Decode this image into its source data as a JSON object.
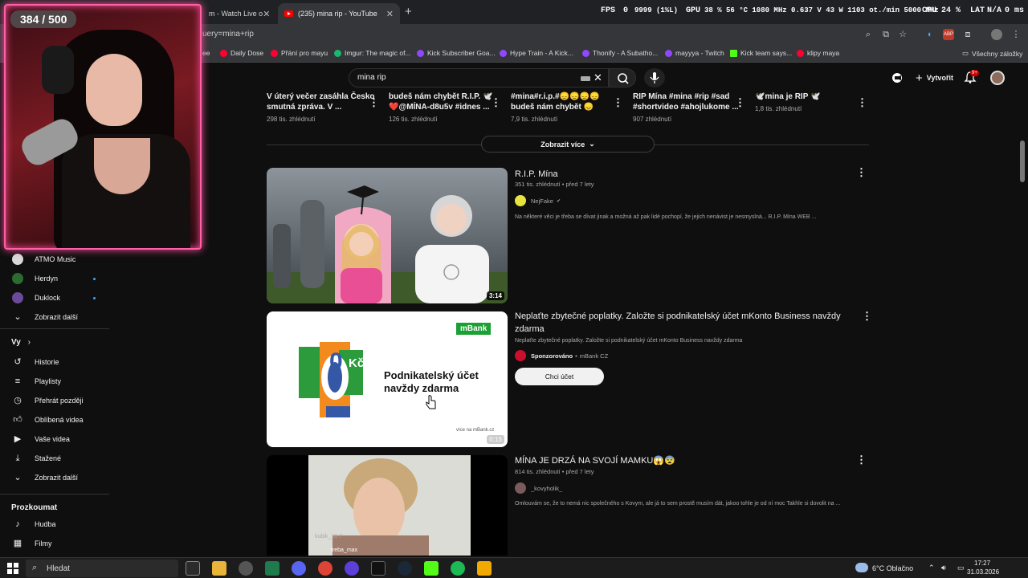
{
  "browser": {
    "tabs": [
      {
        "title": "m - Watch Live o"
      },
      {
        "title": "(235) mina rip - YouTube"
      }
    ],
    "new_tab": "+",
    "url": "uery=mina+rip",
    "bookmarks": [
      {
        "label": "ee",
        "color": "#cccccc"
      },
      {
        "label": "Daily Dose",
        "color": "#ff0033"
      },
      {
        "label": "Přání pro mayu",
        "color": "#ff0033"
      },
      {
        "label": "Imgur: The magic of...",
        "color": "#1bb76e"
      },
      {
        "label": "Kick Subscriber Goa...",
        "color": "#9147ff"
      },
      {
        "label": "Hype Train - A Kick...",
        "color": "#9147ff"
      },
      {
        "label": "Thonify - A Subatho...",
        "color": "#9147ff"
      },
      {
        "label": "mayyya - Twitch",
        "color": "#9147ff"
      },
      {
        "label": "Kick team says...",
        "color": "#53fc18"
      },
      {
        "label": "klipy maya",
        "color": "#ff0033"
      }
    ],
    "all_bookmarks": "Všechny záložky"
  },
  "overlay": {
    "fps_label": "FPS",
    "fps_value": "0",
    "fps_low": "9999 (1%L)",
    "gpu_label": "GPU",
    "gpu_values": "38 %  56 °C  1080 MHz  0.637 V  43 W  1103 ot./min  5000 MHz",
    "cpu_label": "CPU",
    "cpu_value": "24 %",
    "lat_label": "LAT",
    "lat_value": "N/A",
    "ms_value": "0 ms"
  },
  "header": {
    "search_value": "mina rip",
    "create_label": "Vytvořit",
    "notifications": "9+"
  },
  "webcam": {
    "counter": "384 / 500"
  },
  "shorts": [
    {
      "title": "V úterý večer zasáhla Česko smutná zpráva. V ...",
      "views": "298 tis. zhlédnutí"
    },
    {
      "title": "budeš nám chybět R.I.P. 🕊️ ❤️@MÍNA-d8u5v #idnes ...",
      "views": "126 tis. zhlédnutí"
    },
    {
      "title": "#mina#r.i.p.#😞😞😞😞 budeš nám chybět 😞",
      "views": "7,9 tis. zhlédnutí"
    },
    {
      "title": "RIP Mína #mina #rip #sad #shortvideo #ahojlukome ...",
      "views": "907 zhlédnutí"
    },
    {
      "title": "🕊️mina je RIP 🕊️",
      "views": "1,8 tis. zhlédnutí"
    }
  ],
  "show_more": "Zobrazit více",
  "videos": [
    {
      "title": "R.I.P. Mína",
      "meta": "351 tis. zhlédnutí  •  před 7 lety",
      "channel": "NejFake",
      "verified": "✔",
      "description": "Na některé věci je třeba se dívat jinak a možná až pak lidé pochopí, že jejich nenávist je nesmyslná... R.I.P. Mína WEB ...",
      "duration": "3:14"
    },
    {
      "title": "Neplaťte zbytečné poplatky. Založte si podnikatelský účet mKonto Business navždy zdarma",
      "description": "Neplaťte zbytečné poplatky. Založte si podnikatelský účet mKonto Business navždy zdarma",
      "sponsored": "Sponzorováno",
      "channel": "mBank CZ",
      "cta": "Chci účet",
      "ad_brand": "mBank",
      "ad_big": "0",
      "ad_currency": "Kč",
      "ad_line1": "Podnikatelský účet",
      "ad_line2": "navždy zdarma",
      "ad_footer": "více na mBank.cz",
      "duration": "0:15"
    },
    {
      "title": "MÍNA JE DRZÁ NA SVOJÍ MAMKU😱😨",
      "meta": "814 tis. zhlédnutí  •  před 7 lety",
      "channel": "_kovyholik_",
      "description": "Omlouvám se, že to nemá nic společného s Kovym, ale já to sem prostě musím dát, jakoo tohle je od ní moc Takhle si dovolit na ...",
      "overlay_user1": "kubik_10.7",
      "overlay_user2": "treba_max"
    }
  ],
  "sidebar": {
    "channels": [
      {
        "label": "ATMO Music",
        "color": "#d8d8d8",
        "live": false
      },
      {
        "label": "Herdyn",
        "color": "#2a6b2f",
        "live": true
      },
      {
        "label": "Duklock",
        "color": "#6a4a9a",
        "live": true
      }
    ],
    "show_more_1": "Zobrazit další",
    "you_heading": "Vy",
    "you_items": [
      {
        "label": "Historie",
        "icon": "history-icon"
      },
      {
        "label": "Playlisty",
        "icon": "playlist-icon"
      },
      {
        "label": "Přehrát později",
        "icon": "clock-icon"
      },
      {
        "label": "Oblíbená videa",
        "icon": "thumbs-up-icon"
      },
      {
        "label": "Vaše videa",
        "icon": "play-icon"
      },
      {
        "label": "Stažené",
        "icon": "download-icon"
      }
    ],
    "show_more_2": "Zobrazit další",
    "explore_heading": "Prozkoumat",
    "explore_items": [
      {
        "label": "Hudba",
        "icon": "music-icon"
      },
      {
        "label": "Filmy",
        "icon": "film-icon"
      }
    ]
  },
  "taskbar": {
    "search_label": "Hledat",
    "weather": "6°C  Oblačno",
    "time": "17:27",
    "date": "31.03.2026"
  }
}
